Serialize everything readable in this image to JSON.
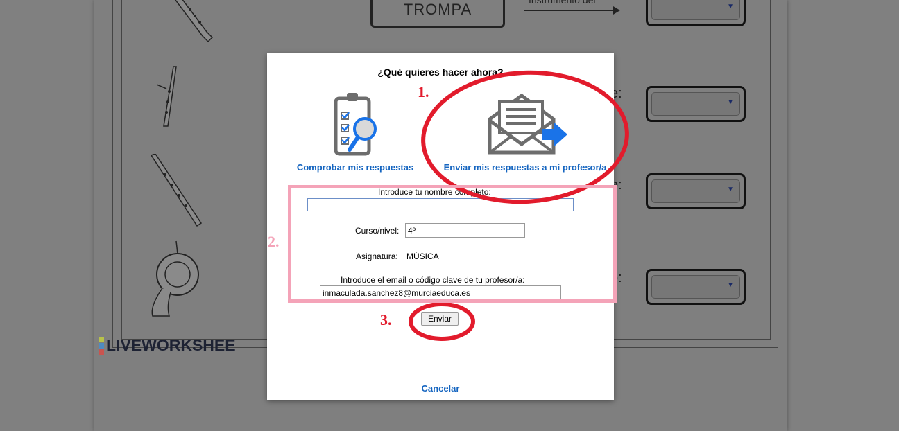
{
  "background": {
    "trompa_label": "TROMPA",
    "arrow_label": "Instrumento del",
    "side_texts": [
      "e:",
      "e:",
      "e:"
    ],
    "logo_letters": [
      "L",
      "I",
      "V",
      "E"
    ],
    "logo_text": "LIVEWORKSHEE",
    "select_arrow": "▼"
  },
  "dialog": {
    "title": "¿Qué quieres hacer ahora?",
    "option_check": {
      "label": "Comprobar mis respuestas",
      "icon": "checklist-magnifier-icon"
    },
    "option_send": {
      "label": "Enviar mis respuestas a mi profesor/a",
      "icon": "envelope-arrow-icon"
    },
    "form": {
      "name_label": "Introduce tu nombre completo:",
      "name_value": "",
      "level_label": "Curso/nivel:",
      "level_value": "4º",
      "subject_label": "Asignatura:",
      "subject_value": "MÚSICA",
      "email_label": "Introduce el email o código clave de tu profesor/a:",
      "email_value": "inmaculada.sanchez8@murciaeduca.es"
    },
    "submit_label": "Enviar",
    "cancel_label": "Cancelar"
  },
  "annotations": {
    "step1": "1.",
    "step2": "2.",
    "step3": "3.",
    "red_color": "#e21b2c",
    "pink_color": "#f4a3b8"
  },
  "colors": {
    "link_blue": "#1565c0",
    "icon_gray": "#6d6d6d",
    "icon_blue": "#1a73e8"
  }
}
